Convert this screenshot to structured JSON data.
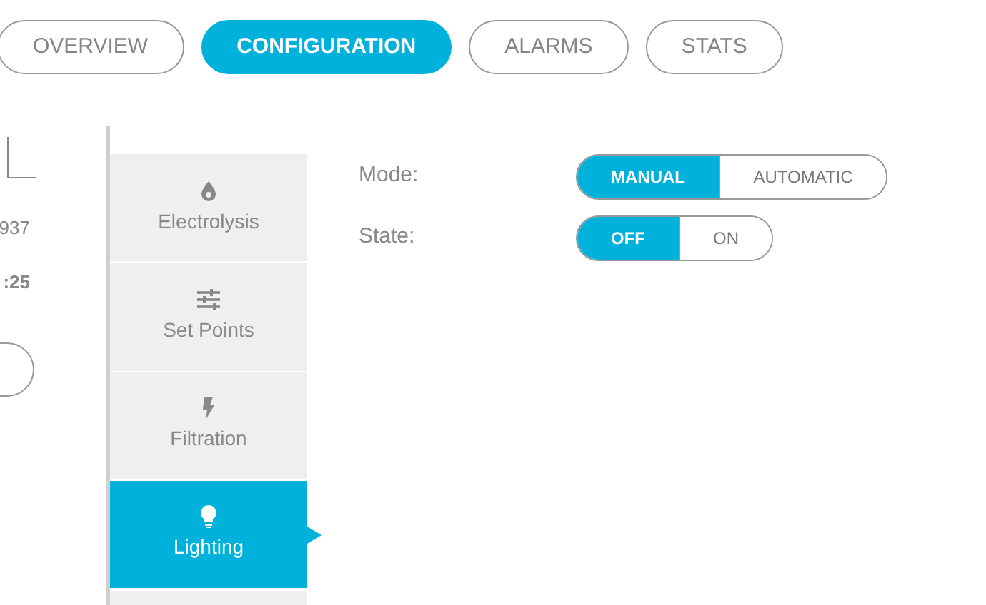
{
  "tabs": [
    {
      "label": "OVERVIEW",
      "selected": false
    },
    {
      "label": "CONFIGURATION",
      "selected": true
    },
    {
      "label": "ALARMS",
      "selected": false
    },
    {
      "label": "STATS",
      "selected": false
    }
  ],
  "left_panel": {
    "value_1": "937",
    "value_2": ":25"
  },
  "menu": [
    {
      "label": "Electrolysis",
      "selected": false
    },
    {
      "label": "Set Points",
      "selected": false
    },
    {
      "label": "Filtration",
      "selected": false
    },
    {
      "label": "Lighting",
      "selected": true
    }
  ],
  "settings": [
    {
      "label": "Mode:",
      "options": [
        {
          "label": "MANUAL",
          "selected": true
        },
        {
          "label": "AUTOMATIC",
          "selected": false
        }
      ]
    },
    {
      "label": "State:",
      "options": [
        {
          "label": "OFF",
          "selected": true
        },
        {
          "label": "ON",
          "selected": false
        }
      ]
    }
  ]
}
